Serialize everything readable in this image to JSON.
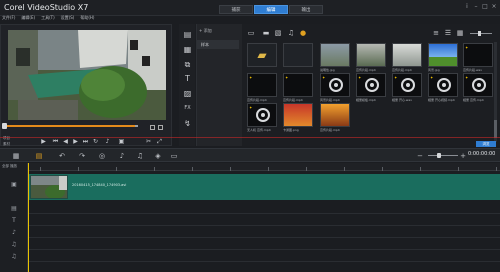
{
  "app": {
    "title": "Corel VideoStudio X7"
  },
  "menu": [
    "文件(F)",
    "编辑(E)",
    "工具(T)",
    "设置(S)",
    "帮助(H)"
  ],
  "tabs": [
    {
      "label": "捕获"
    },
    {
      "label": "编辑"
    },
    {
      "label": "输出"
    }
  ],
  "preview": {
    "mode_labels": [
      "项目",
      "素材"
    ],
    "position_fraction": 0.98
  },
  "library": {
    "add_label": "+ 添加",
    "folder_label": "样本",
    "browse_label": "浏览",
    "thumbnails": [
      {
        "caption": "",
        "type": "folder"
      },
      {
        "caption": "",
        "type": "blank"
      },
      {
        "caption": "说明性.jpg",
        "type": "photo-a"
      },
      {
        "caption": "宣传片段.mp4",
        "type": "photo-b"
      },
      {
        "caption": "宣传片段.mp4",
        "type": "photo-c"
      },
      {
        "caption": "风景.jpg",
        "type": "sky"
      },
      {
        "caption": "宣传片段.wav",
        "type": "dark"
      },
      {
        "caption": "宣传片段.mp4",
        "type": "dark"
      },
      {
        "caption": "宣传片段.mp4",
        "type": "dark"
      },
      {
        "caption": "风景片段.mp4",
        "type": "disc"
      },
      {
        "caption": "相册模板.mp4",
        "type": "disc"
      },
      {
        "caption": "相册 开心.wav",
        "type": "disc"
      },
      {
        "caption": "相册 开心视频.mp4",
        "type": "disc"
      },
      {
        "caption": "相册 宣传.mp4",
        "type": "disc"
      },
      {
        "caption": "无人机 宣传.mp4",
        "type": "disc"
      },
      {
        "caption": "卡通图.png",
        "type": "logo"
      },
      {
        "caption": "宣传片段.mp4",
        "type": "orange"
      }
    ]
  },
  "timeline": {
    "all_tracks_label": "全部 播放",
    "clip_name": "20160415_174840_174903.avi",
    "timecode": "0:00:00:00",
    "zoom_fraction": 0.35
  }
}
